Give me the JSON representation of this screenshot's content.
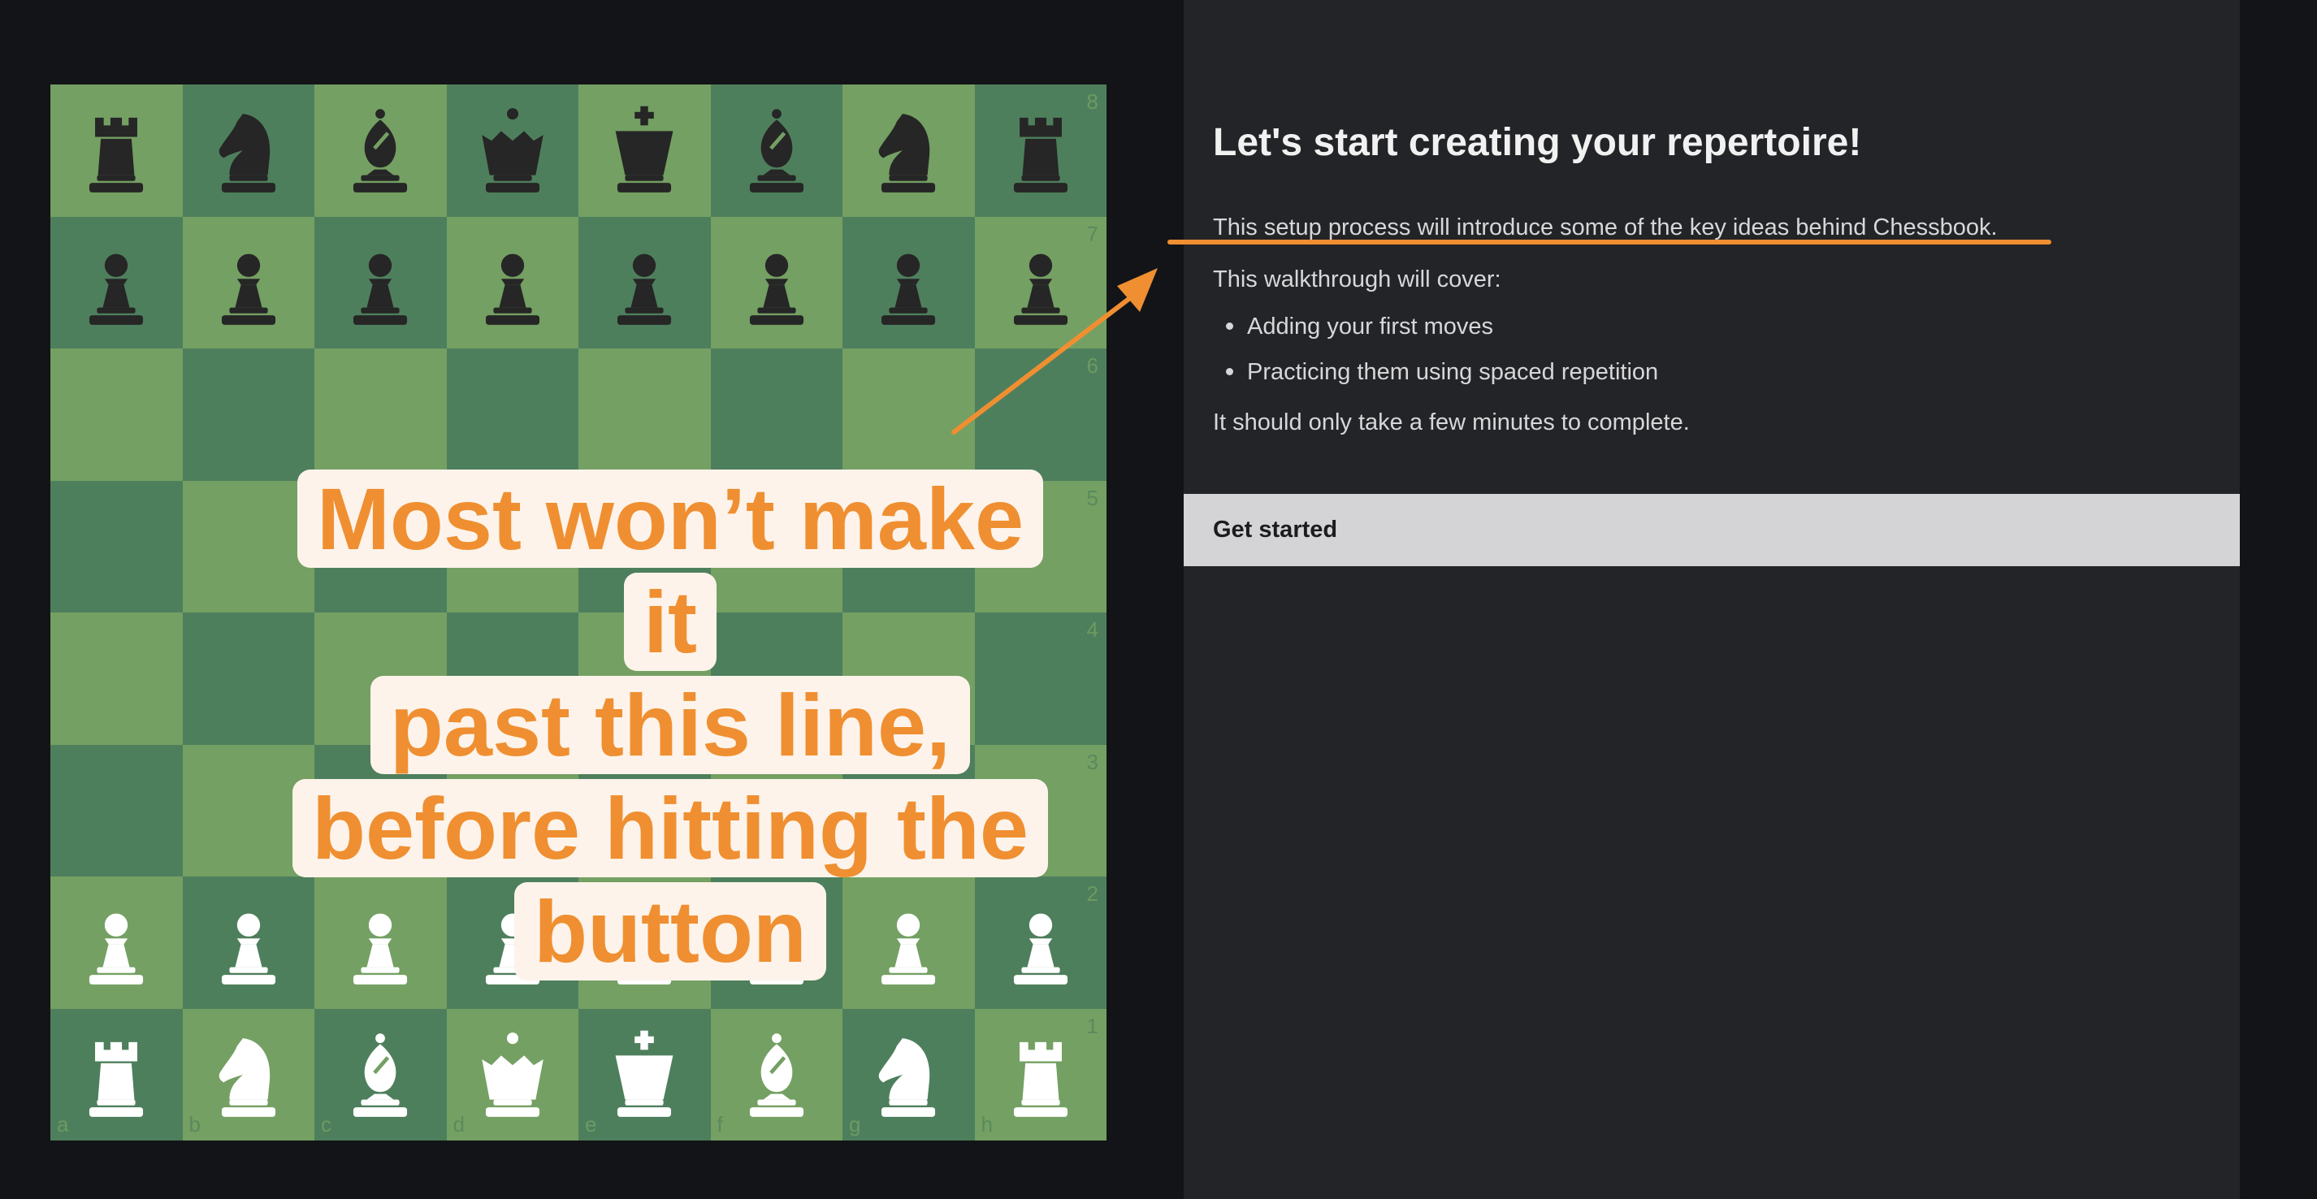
{
  "board": {
    "rank_labels": [
      "8",
      "7",
      "6",
      "5",
      "4",
      "3",
      "2",
      "1"
    ],
    "file_labels": [
      "a",
      "b",
      "c",
      "d",
      "e",
      "f",
      "g",
      "h"
    ],
    "rows": [
      [
        "black-rook",
        "black-knight",
        "black-bishop",
        "black-queen",
        "black-king",
        "black-bishop",
        "black-knight",
        "black-rook"
      ],
      [
        "black-pawn",
        "black-pawn",
        "black-pawn",
        "black-pawn",
        "black-pawn",
        "black-pawn",
        "black-pawn",
        "black-pawn"
      ],
      [
        "",
        "",
        "",
        "",
        "",
        "",
        "",
        ""
      ],
      [
        "",
        "",
        "",
        "",
        "",
        "",
        "",
        ""
      ],
      [
        "",
        "",
        "",
        "",
        "",
        "",
        "",
        ""
      ],
      [
        "",
        "",
        "",
        "",
        "",
        "",
        "",
        ""
      ],
      [
        "white-pawn",
        "white-pawn",
        "white-pawn",
        "white-pawn",
        "white-pawn",
        "white-pawn",
        "white-pawn",
        "white-pawn"
      ],
      [
        "white-rook",
        "white-knight",
        "white-bishop",
        "white-queen",
        "white-king",
        "white-bishop",
        "white-knight",
        "white-rook"
      ]
    ],
    "light_color": "#74a063",
    "dark_color": "#4e7f5c"
  },
  "overlay": {
    "lines": [
      "Most won’t make it",
      "past this line,",
      "before hitting the",
      "button"
    ],
    "text_color": "#ef8f31",
    "highlight_color": "#fdf3ea"
  },
  "panel": {
    "title": "Let's start creating your repertoire!",
    "intro": "This setup process will introduce some of the key ideas behind Chessbook.",
    "cover_heading": "This walkthrough will cover:",
    "bullets": [
      "Adding your first moves",
      "Practicing them using spaced repetition"
    ],
    "closing": "It should only take a few minutes to complete.",
    "button_label": "Get started"
  },
  "annotation": {
    "color": "#ef8f31"
  }
}
